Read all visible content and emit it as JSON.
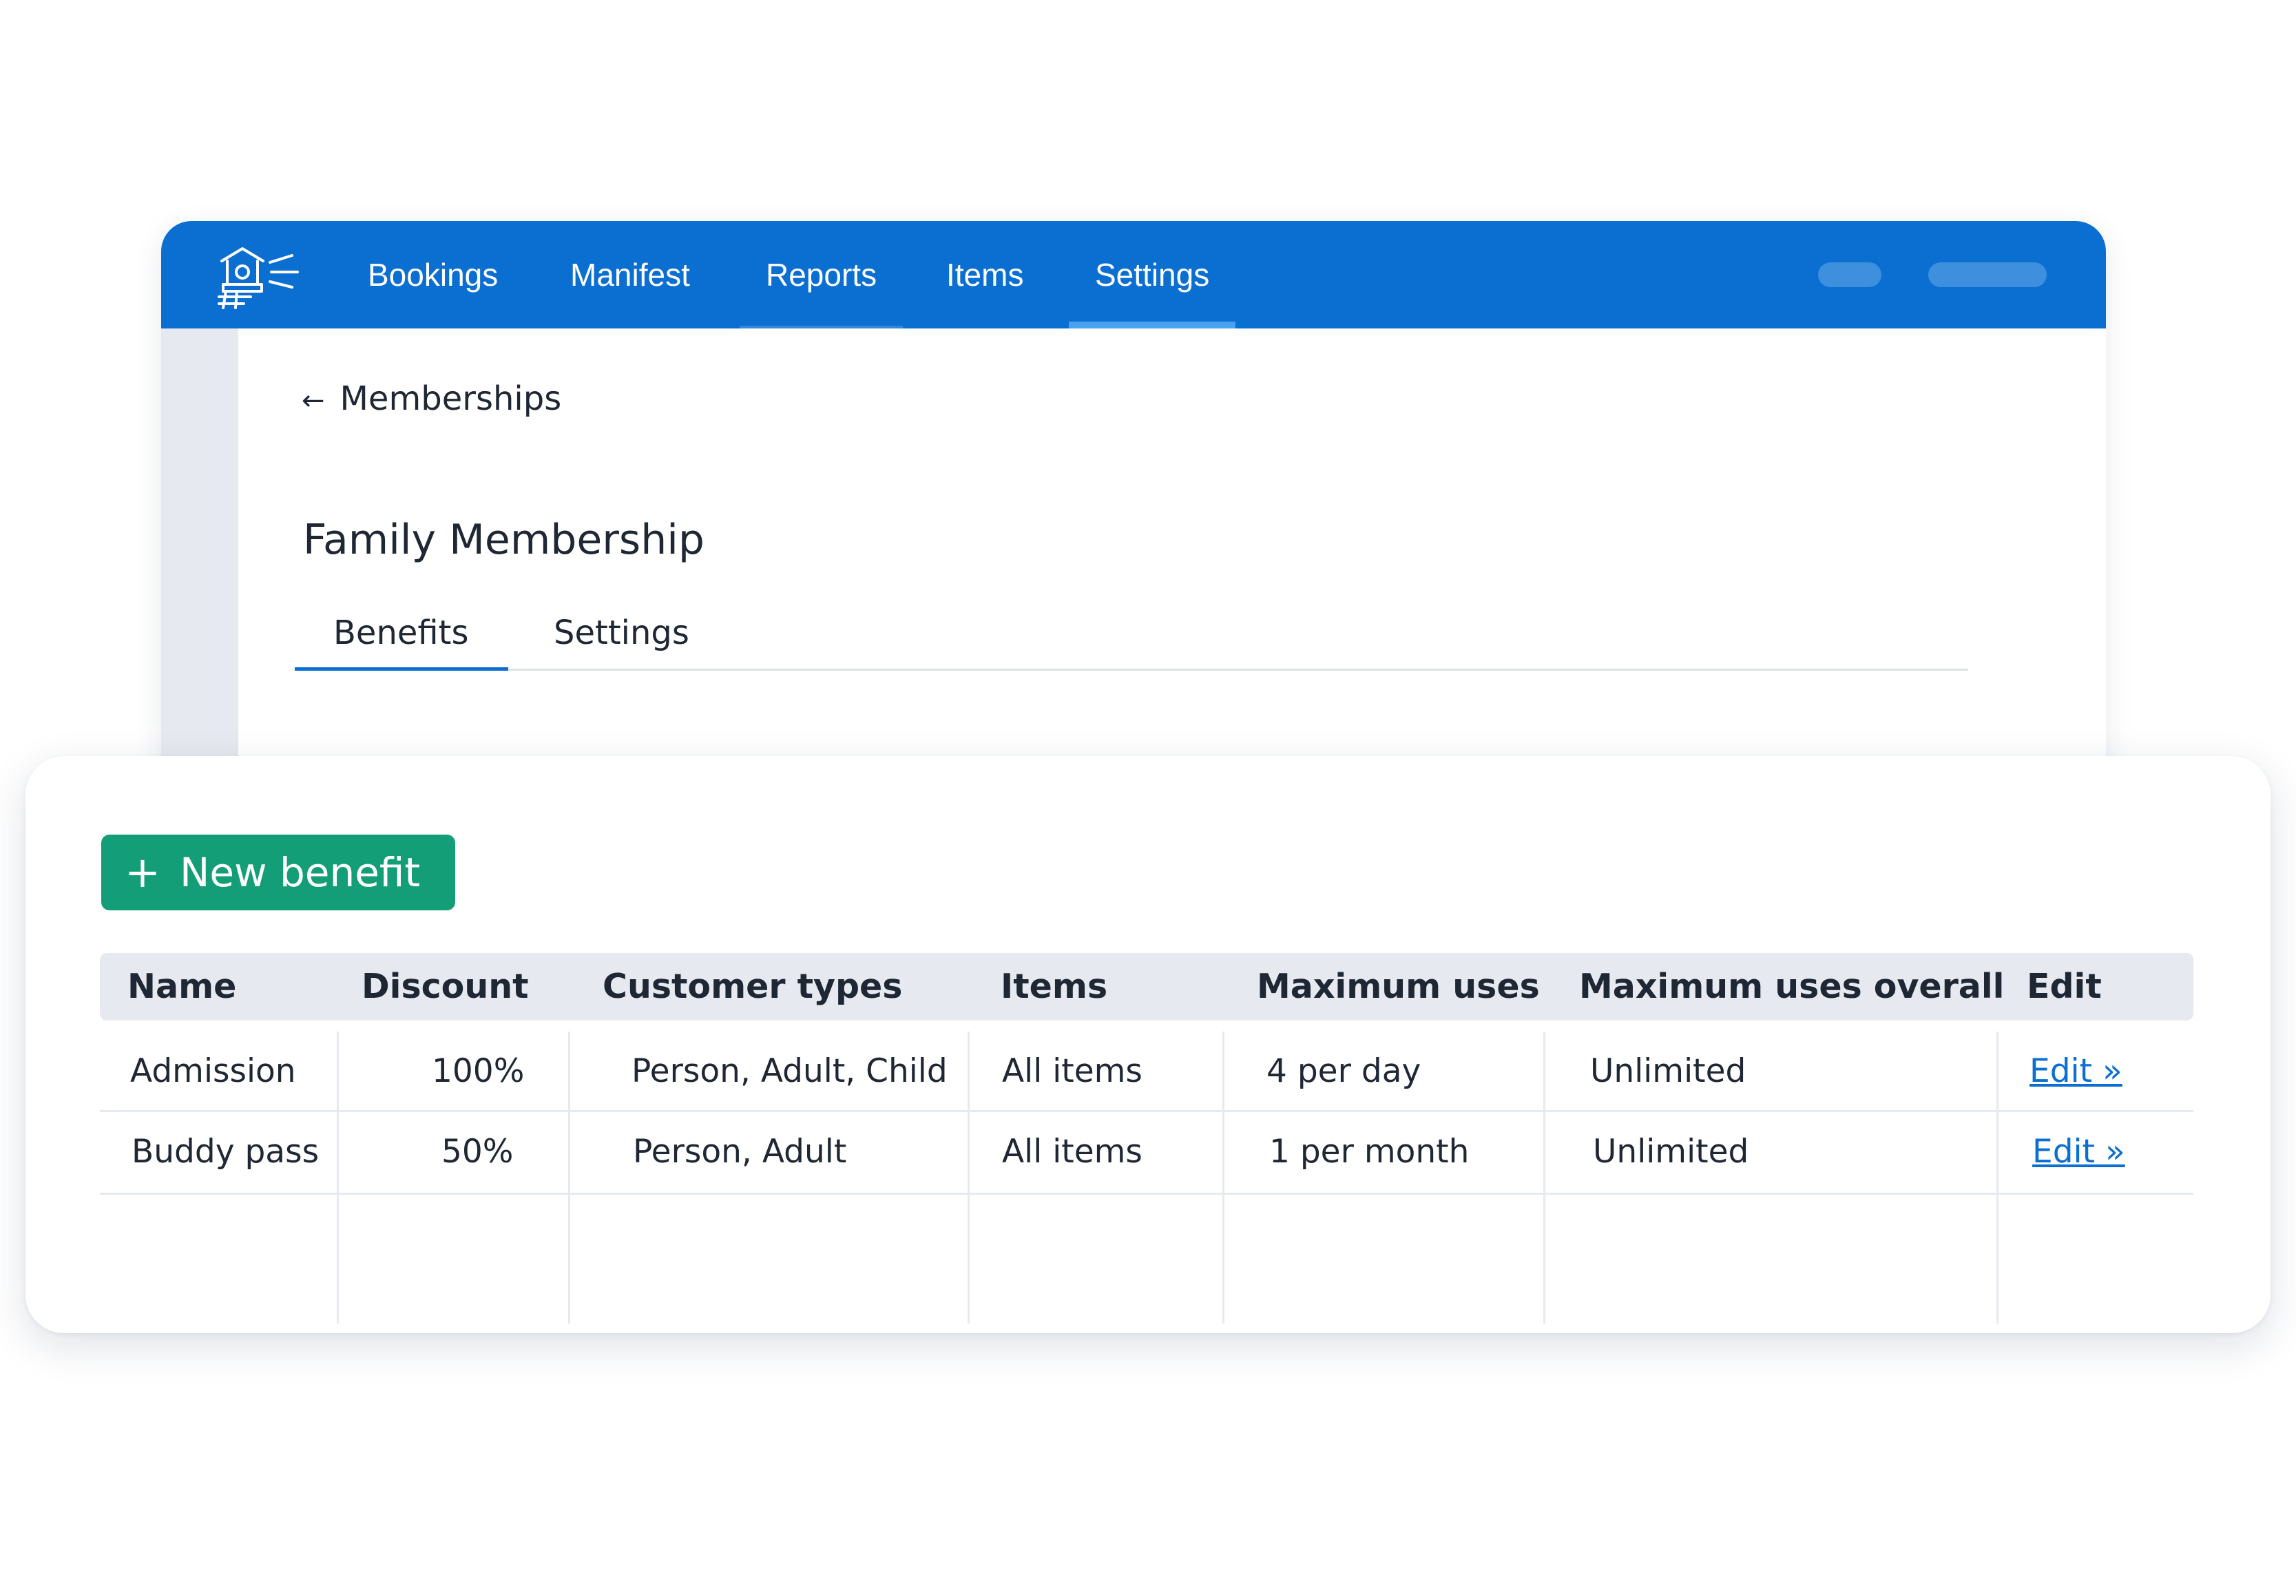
{
  "nav": {
    "items": [
      {
        "label": "Bookings"
      },
      {
        "label": "Manifest"
      },
      {
        "label": "Reports"
      },
      {
        "label": "Items"
      },
      {
        "label": "Settings"
      }
    ],
    "active": "Settings",
    "brand_color": "#0b6ed1"
  },
  "breadcrumb": {
    "back_icon": "arrow-left-icon",
    "label": "Memberships"
  },
  "page": {
    "title": "Family Membership"
  },
  "tabs": [
    {
      "label": "Benefits",
      "active": true
    },
    {
      "label": "Settings",
      "active": false
    }
  ],
  "actions": {
    "new_benefit_label": "New benefit",
    "new_benefit_icon": "plus-icon",
    "button_color": "#139e78"
  },
  "table": {
    "columns": [
      "Name",
      "Discount",
      "Customer types",
      "Items",
      "Maximum uses",
      "Maximum uses overall",
      "Edit"
    ],
    "rows": [
      {
        "name": "Admission",
        "discount": "100%",
        "customer_types": "Person, Adult, Child",
        "items": "All items",
        "max_uses": "4 per day",
        "max_overall": "Unlimited",
        "edit": "Edit »"
      },
      {
        "name": "Buddy pass",
        "discount": "50%",
        "customer_types": "Person, Adult",
        "items": "All items",
        "max_uses": "1 per month",
        "max_overall": "Unlimited",
        "edit": "Edit »"
      }
    ]
  }
}
